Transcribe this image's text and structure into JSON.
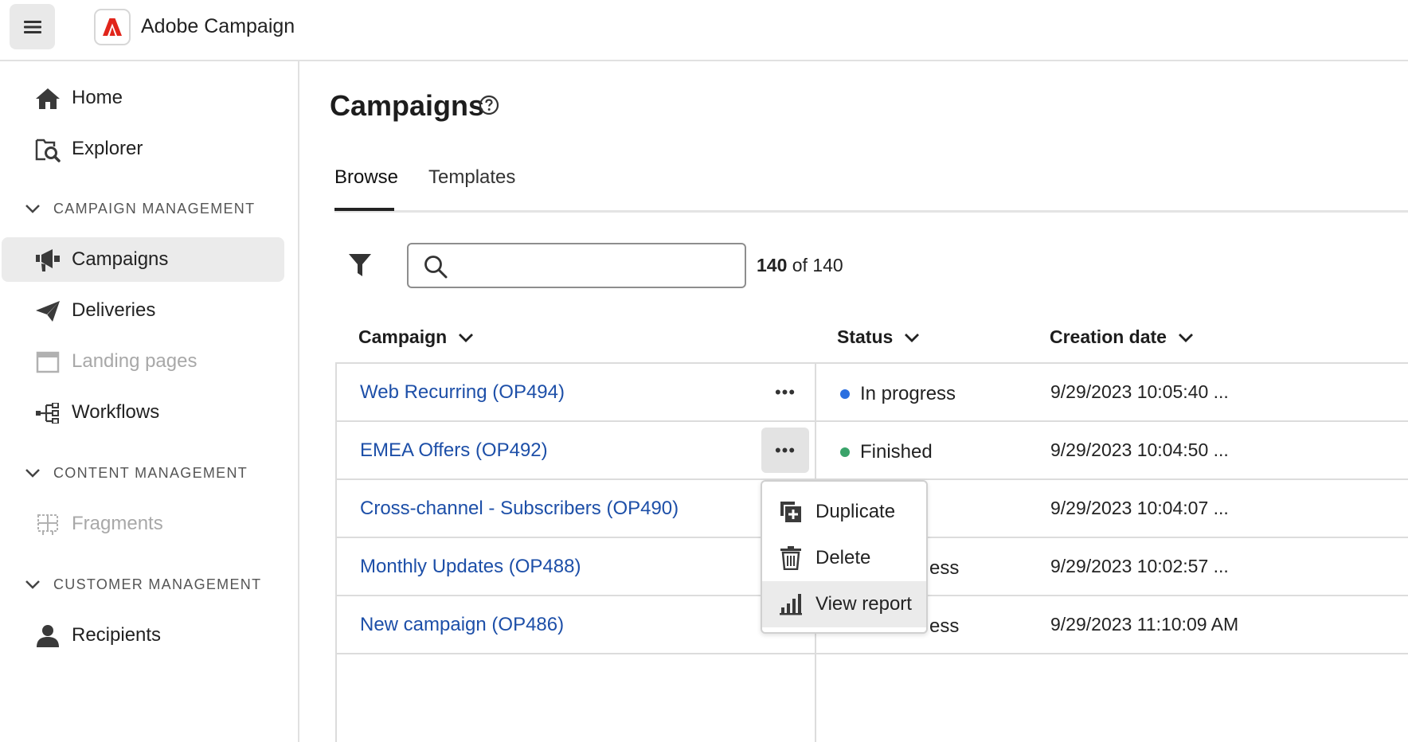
{
  "app": {
    "title": "Adobe Campaign"
  },
  "sidebar": {
    "top_items": [
      {
        "label": "Home",
        "icon": "home-icon"
      },
      {
        "label": "Explorer",
        "icon": "explorer-icon"
      }
    ],
    "sections": [
      {
        "title": "CAMPAIGN MANAGEMENT",
        "items": [
          {
            "label": "Campaigns",
            "icon": "megaphone-icon",
            "active": true
          },
          {
            "label": "Deliveries",
            "icon": "paper-plane-icon"
          },
          {
            "label": "Landing pages",
            "icon": "landing-page-icon",
            "disabled": true
          },
          {
            "label": "Workflows",
            "icon": "workflow-icon"
          }
        ]
      },
      {
        "title": "CONTENT MANAGEMENT",
        "items": [
          {
            "label": "Fragments",
            "icon": "fragment-icon",
            "disabled": true
          }
        ]
      },
      {
        "title": "CUSTOMER MANAGEMENT",
        "items": [
          {
            "label": "Recipients",
            "icon": "user-icon"
          }
        ]
      }
    ]
  },
  "main": {
    "title": "Campaigns",
    "tabs": [
      {
        "label": "Browse",
        "active": true
      },
      {
        "label": "Templates"
      }
    ],
    "search": {
      "value": "",
      "placeholder": ""
    },
    "count": {
      "shown": "140",
      "rest": " of 140"
    },
    "columns": [
      {
        "label": "Campaign"
      },
      {
        "label": "Status"
      },
      {
        "label": "Creation date"
      }
    ],
    "rows": [
      {
        "name": "Web Recurring (OP494)",
        "status": "In progress",
        "status_color": "#2b6fe0",
        "date": "9/29/2023 10:05:40 ..."
      },
      {
        "name": "EMEA Offers (OP492)",
        "status": "Finished",
        "status_color": "#3aa36a",
        "date": "9/29/2023 10:04:50 ..."
      },
      {
        "name": "Cross-channel - Subscribers (OP490)",
        "status": "",
        "status_color": "",
        "date": "9/29/2023 10:04:07 ..."
      },
      {
        "name": "Monthly Updates (OP488)",
        "status": "ess",
        "status_color": "",
        "date": "9/29/2023 10:02:57 ..."
      },
      {
        "name": "New campaign (OP486)",
        "status": "ess",
        "status_color": "",
        "date": "9/29/2023 11:10:09 AM"
      }
    ],
    "more_label": "•••"
  },
  "context_menu": {
    "items": [
      {
        "label": "Duplicate",
        "icon": "duplicate-icon"
      },
      {
        "label": "Delete",
        "icon": "trash-icon"
      },
      {
        "label": "View report",
        "icon": "bar-chart-icon"
      }
    ]
  }
}
